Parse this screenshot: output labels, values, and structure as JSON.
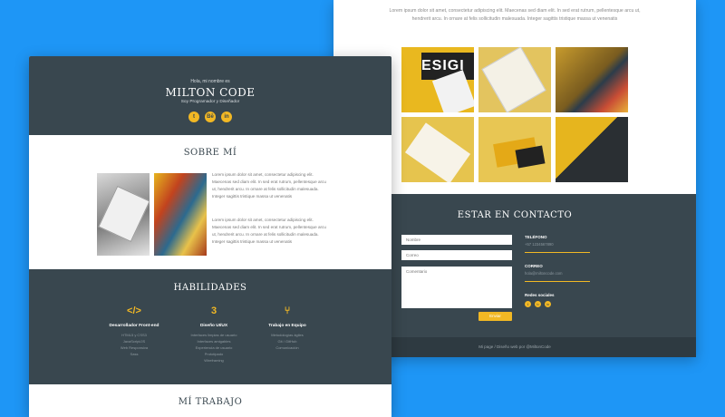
{
  "back": {
    "intro": "Lorem ipsum dolor sit amet, consectetur adipiscing elit. Maecenas sed diam elit. In sed erat rutrum, pellentesque arcu ut, hendrerit arcu. In ornare at felis sollicitudin malesuada. Integer sagittis tristique massa ut venenatis",
    "contact": {
      "title": "ESTAR EN CONTACTO",
      "name_placeholder": "Nombre",
      "email_placeholder": "Correo",
      "comment_placeholder": "Comentario",
      "send_label": "Enviar",
      "phone_label": "TELÉFONO",
      "phone_value": "+57 1234567890",
      "email_label": "CORREO",
      "email_value": "hola@miltoncode.com",
      "social_label": "Redes sociales"
    },
    "footer": "Mi page / Diseño web por @MiltonCode"
  },
  "front": {
    "greeting": "Hola, mi nombre es",
    "name": "MILTON CODE",
    "role": "Soy Programador y Diseñador",
    "social_icons": [
      "twitter-icon",
      "behance-icon",
      "linkedin-icon"
    ],
    "about_title": "SOBRE MÍ",
    "about_p1": "Lorem ipsum dolor sit amet, consectetur adipiscing elit. Maecenas sed diam elit. In sed erat rutrum, pellentesque arcu ut, hendrerit arcu. In ornare at felis sollicitudin malesuada. Integer sagittis tristique massa ut venenatis",
    "about_p2": "Lorem ipsum dolor sit amet, consectetur adipiscing elit. Maecenas sed diam elit. In sed erat rutrum, pellentesque arcu ut, hendrerit arcu. In ornare at felis sollicitudin malesuada. Integer sagittis tristique massa ut venenatis",
    "skills_title": "HABILIDADES",
    "skills": [
      {
        "icon": "</>",
        "title": "Desarrollador Front-end",
        "lines": [
          "HTML5 y CSS3",
          "JavaScript/JS",
          "Web Responsiva",
          "Sass"
        ]
      },
      {
        "icon": "3",
        "title": "Diseño UI/UX",
        "lines": [
          "Interfaces limpias de usuario",
          "Interfaces amigables",
          "Experiencia de usuario",
          "Prototipado",
          "Wireframing"
        ]
      },
      {
        "icon": "⑂",
        "title": "Trabajo en Equipo",
        "lines": [
          "Metodologías ágiles",
          "Git / GitHub",
          "Comunicación"
        ]
      }
    ],
    "work_title": "MÍ TRABAJO"
  },
  "colors": {
    "accent": "#f2b824",
    "dark": "#39474f",
    "bg": "#1e96f6"
  }
}
